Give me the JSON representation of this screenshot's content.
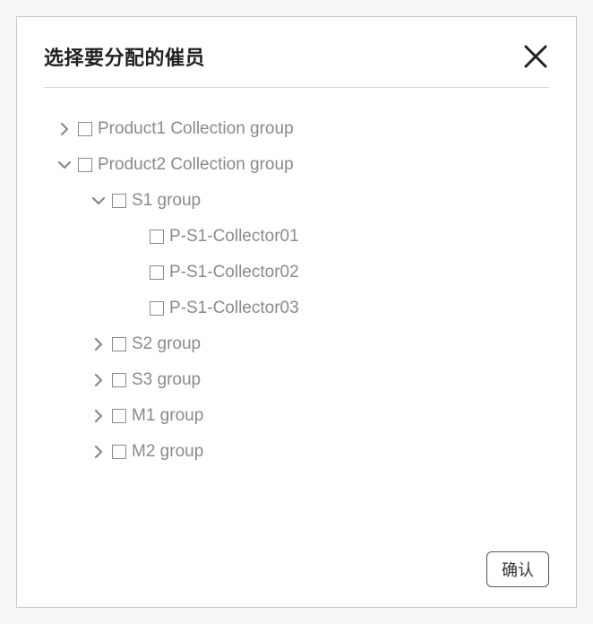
{
  "dialog": {
    "title": "选择要分配的催员",
    "confirm_label": "确认"
  },
  "tree": [
    {
      "level": 0,
      "expanded": false,
      "has_children": true,
      "label": "Product1 Collection group"
    },
    {
      "level": 0,
      "expanded": true,
      "has_children": true,
      "label": "Product2 Collection group"
    },
    {
      "level": 1,
      "expanded": true,
      "has_children": true,
      "label": "S1 group"
    },
    {
      "level": 2,
      "expanded": false,
      "has_children": false,
      "label": "P-S1-Collector01"
    },
    {
      "level": 2,
      "expanded": false,
      "has_children": false,
      "label": "P-S1-Collector02"
    },
    {
      "level": 2,
      "expanded": false,
      "has_children": false,
      "label": "P-S1-Collector03"
    },
    {
      "level": 1,
      "expanded": false,
      "has_children": true,
      "label": "S2 group"
    },
    {
      "level": 1,
      "expanded": false,
      "has_children": true,
      "label": "S3 group"
    },
    {
      "level": 1,
      "expanded": false,
      "has_children": true,
      "label": "M1 group"
    },
    {
      "level": 1,
      "expanded": false,
      "has_children": true,
      "label": "M2 group"
    }
  ]
}
